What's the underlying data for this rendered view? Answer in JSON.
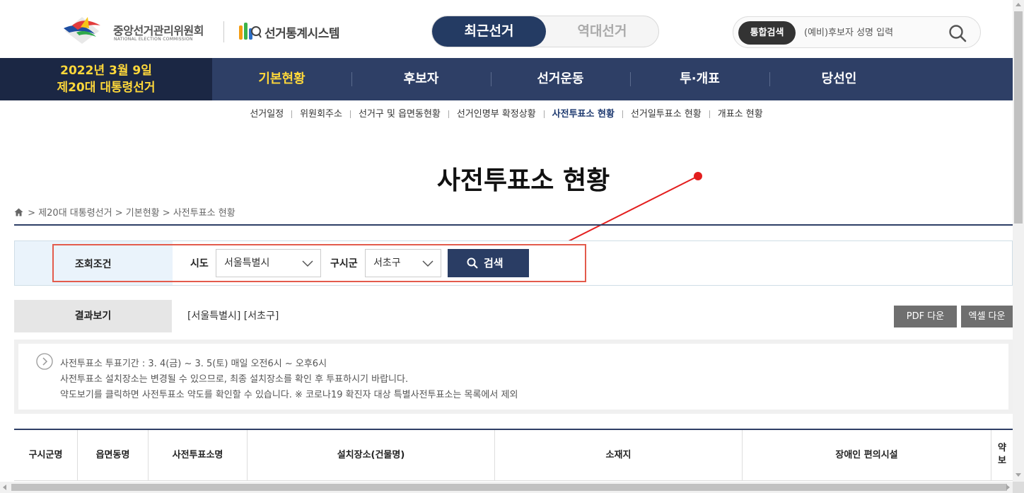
{
  "header": {
    "org_name": "중앙선거관리위원회",
    "org_name_en": "NATIONAL ELECTION COMMISSION",
    "system_name": "선거통계시스템",
    "toggle": {
      "active": "최근선거",
      "inactive": "역대선거"
    },
    "search": {
      "label": "통합검색",
      "placeholder": "(예비)후보자 성명 입력"
    }
  },
  "election": {
    "date": "2022년 3월 9일",
    "name": "제20대 대통령선거"
  },
  "nav": {
    "items": [
      "기본현황",
      "후보자",
      "선거운동",
      "투·개표",
      "당선인"
    ],
    "active_index": 0
  },
  "submenu": {
    "items": [
      "선거일정",
      "위원회주소",
      "선거구 및 읍면동현황",
      "선거인명부 확정상황",
      "사전투표소 현황",
      "선거일투표소 현황",
      "개표소 현황"
    ],
    "active_index": 4
  },
  "page": {
    "title": "사전투표소 현황"
  },
  "breadcrumb": [
    "제20대 대통령선거",
    "기본현황",
    "사전투표소 현황"
  ],
  "filter": {
    "caption": "조회조건",
    "sido_label": "시도",
    "sido_value": "서울특별시",
    "gu_label": "구시군",
    "gu_value": "서초구",
    "search_button": "검색"
  },
  "result": {
    "caption": "결과보기",
    "value": "[서울특별시] [서초구]",
    "pdf_button": "PDF 다운",
    "excel_button": "엑셀 다운"
  },
  "notice": {
    "lines": [
      "사전투표소 투표기간 : 3. 4(금) ~ 3. 5(토) 매일 오전6시 ~ 오후6시",
      "사전투표소 설치장소는 변경될 수 있으므로, 최종 설치장소를 확인 후 투표하시기 바랍니다.",
      "약도보기를 클릭하면 사전투표소 약도를 확인할 수 있습니다. ※ 코로나19 확진자 대상 특별사전투표소는 목록에서 제외"
    ]
  },
  "table": {
    "headers": [
      "구시군명",
      "읍면동명",
      "사전투표소명",
      "설치장소(건물명)",
      "소재지",
      "장애인 편의시설"
    ],
    "last_header_lines": [
      "약",
      "보"
    ]
  },
  "colors": {
    "navy": "#2e3f66",
    "highlight": "#ffd83a",
    "annotation_red": "#e31e1e"
  }
}
